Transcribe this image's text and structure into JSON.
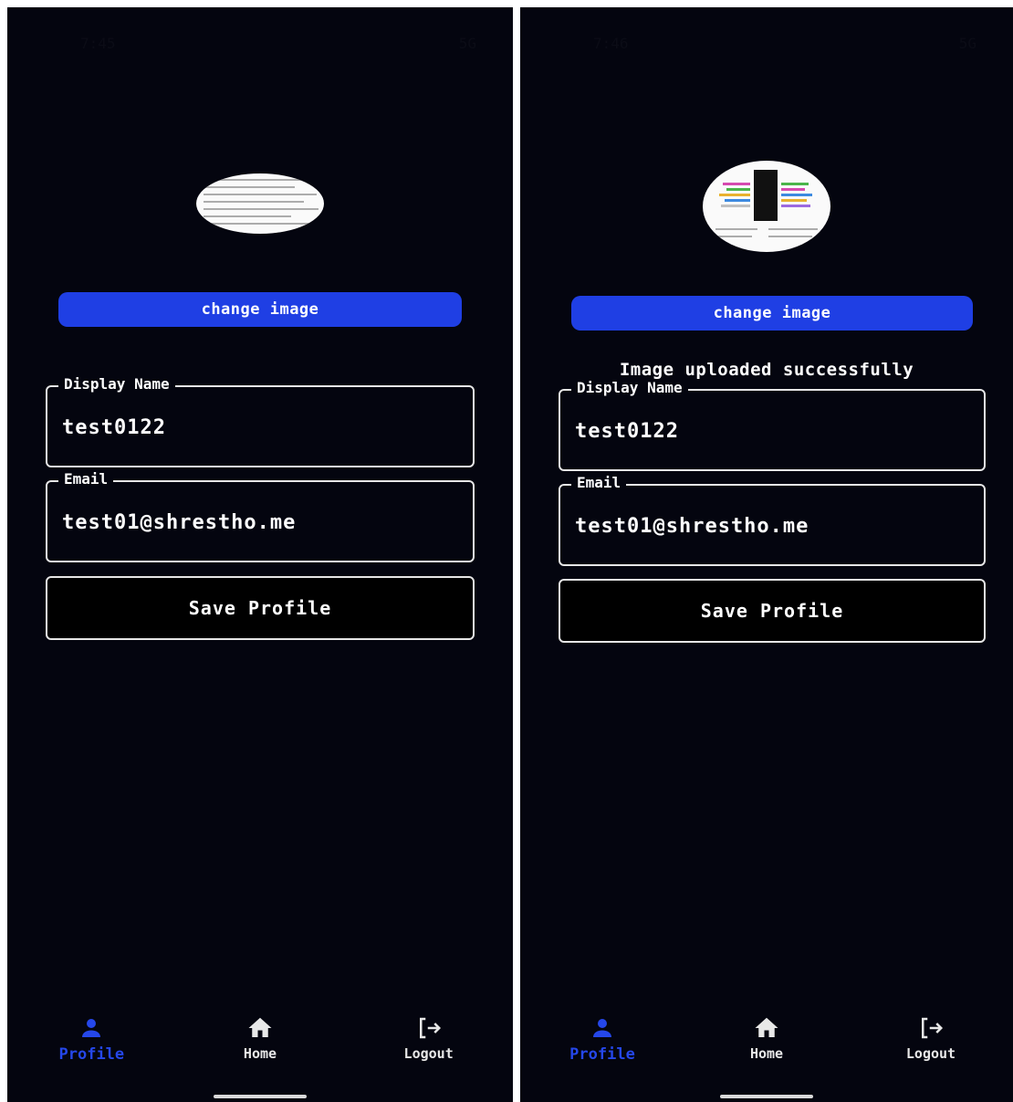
{
  "screens": {
    "left": {
      "status_time": "7:45",
      "status_right": "5G",
      "change_image_label": "change image",
      "success_message": "",
      "display_name": {
        "label": "Display Name",
        "value": "test0122"
      },
      "email": {
        "label": "Email",
        "value": "test01@shrestho.me"
      },
      "save_label": "Save Profile"
    },
    "right": {
      "status_time": "7:46",
      "status_right": "5G",
      "change_image_label": "change image",
      "success_message": "Image uploaded successfully",
      "display_name": {
        "label": "Display Name",
        "value": "test0122"
      },
      "email": {
        "label": "Email",
        "value": "test01@shrestho.me"
      },
      "save_label": "Save Profile"
    }
  },
  "nav": {
    "items": [
      {
        "label": "Profile",
        "icon": "person-icon",
        "active": true
      },
      {
        "label": "Home",
        "icon": "home-icon",
        "active": false
      },
      {
        "label": "Logout",
        "icon": "logout-icon",
        "active": false
      }
    ]
  },
  "colors": {
    "background": "#04050f",
    "accent": "#1f3fe4",
    "active_nav": "#2547ea",
    "border": "#e6e6e6"
  }
}
